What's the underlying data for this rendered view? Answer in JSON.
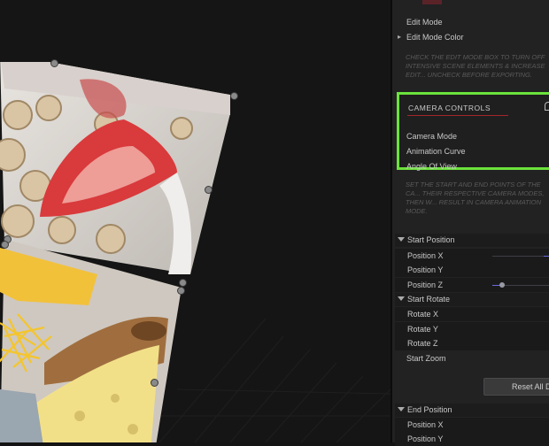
{
  "panel": {
    "edit_mode": "Edit Mode",
    "edit_mode_color": "Edit Mode Color",
    "edit_note": "CHECK THE EDIT MODE BOX TO TURN OFF INTENSIVE SCENE ELEMENTS & INCREASE EDIT... UNCHECK BEFORE EXPORTING.",
    "camera_controls": {
      "title": "CAMERA CONTROLS",
      "items": [
        "Camera Mode",
        "Animation Curve",
        "Angle Of View"
      ]
    },
    "camera_note": "SET THE START AND END POINTS OF THE CA... THEIR RESPECTIVE CAMERA MODES, THEN W... RESULT IN CAMERA ANIMATION MODE.",
    "start_position": {
      "label": "Start Position",
      "rows": [
        {
          "label": "Position X",
          "value": 0.95
        },
        {
          "label": "Position Y",
          "value": null
        },
        {
          "label": "Position Z",
          "value": 0.12
        }
      ]
    },
    "start_rotate": {
      "label": "Start Rotate",
      "rows": [
        "Rotate X",
        "Rotate Y",
        "Rotate Z"
      ]
    },
    "start_zoom": "Start Zoom",
    "reset_all": "Reset All D",
    "end_position": {
      "label": "End Position",
      "rows": [
        "Position X",
        "Position Y"
      ]
    }
  },
  "colors": {
    "highlight": "#6be23b",
    "camera_underline": "#a3262a",
    "panel_bg": "#222223"
  },
  "icons": [
    "chevron-right-icon",
    "collapse-triangle-icon",
    "lock-icon",
    "transform-handle-icon"
  ]
}
